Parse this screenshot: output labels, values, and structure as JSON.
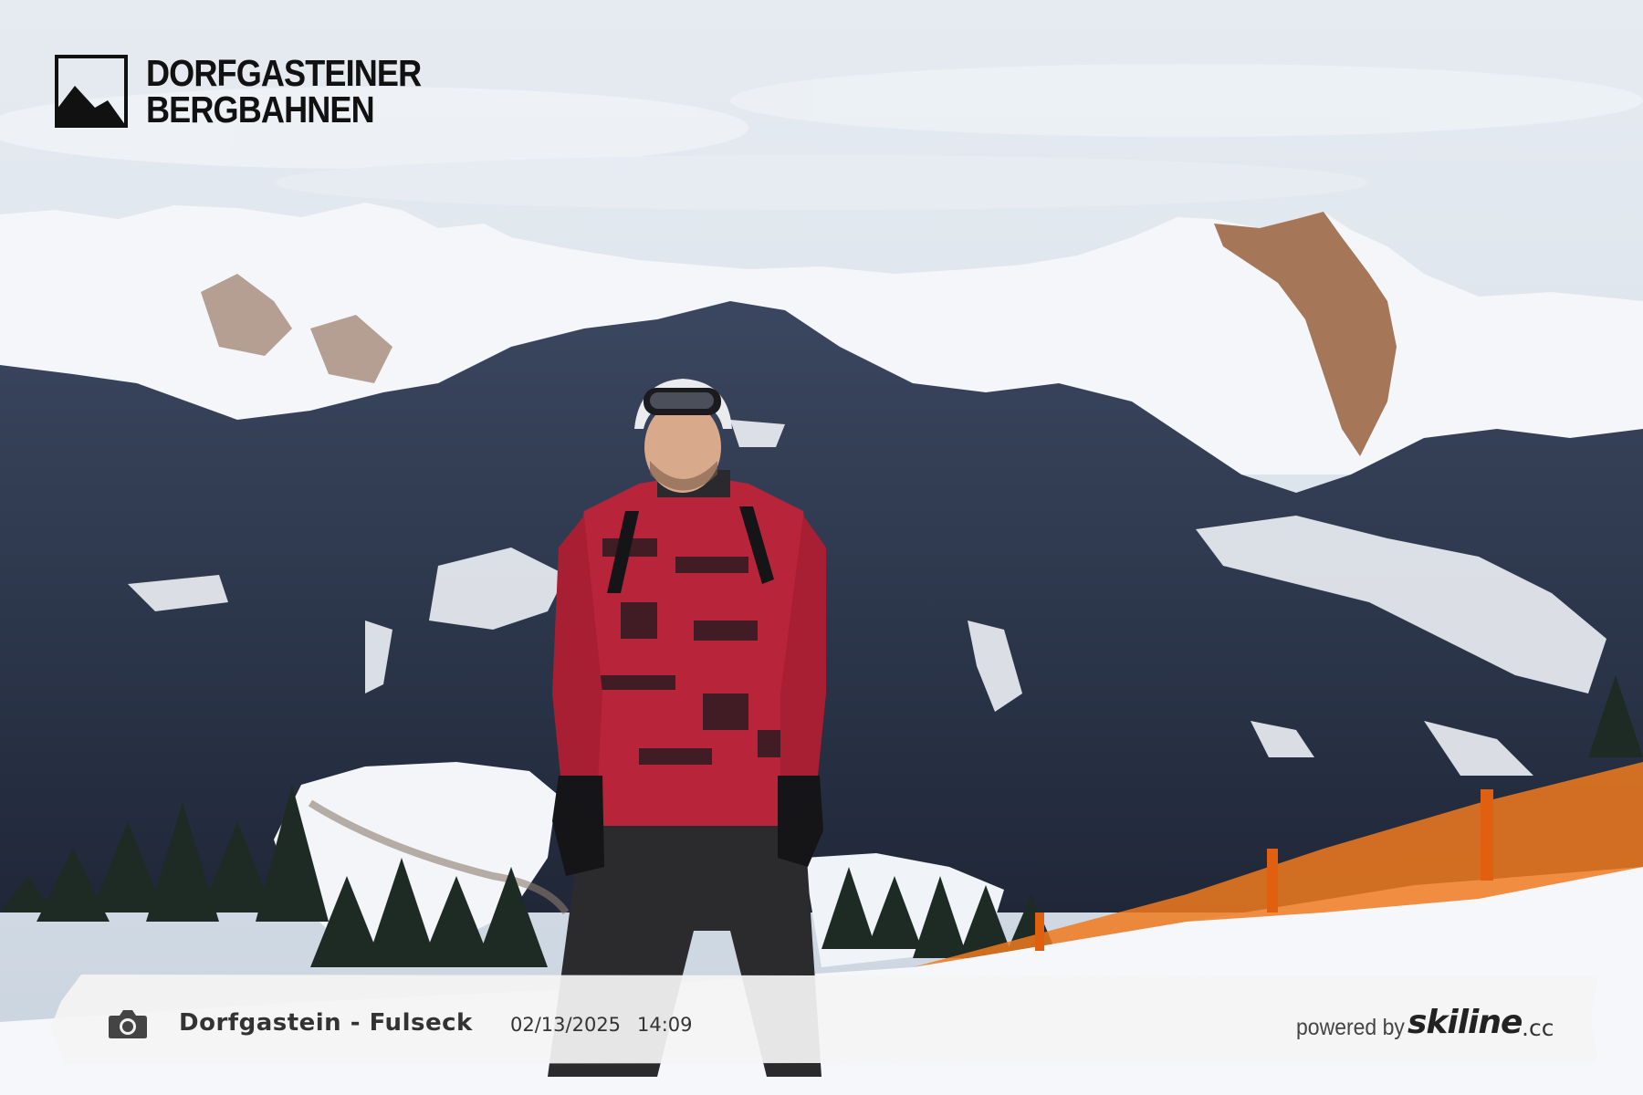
{
  "logo": {
    "line1": "DORFGASTEINER",
    "line2": "BERGBAHNEN",
    "mark_icon": "mountain-logo-icon"
  },
  "caption": {
    "camera_icon": "camera-icon",
    "location": "Dorfgastein - Fulseck",
    "date": "02/13/2025",
    "time": "14:09",
    "powered_by": "powered by",
    "brand_name": "skiline",
    "brand_tld": ".cc"
  },
  "colors": {
    "sky": "#dfe6ee",
    "snow": "#f2f5f8",
    "forest": "#2a3448",
    "jacket": "#b8243a",
    "fence": "#f07a1e"
  }
}
